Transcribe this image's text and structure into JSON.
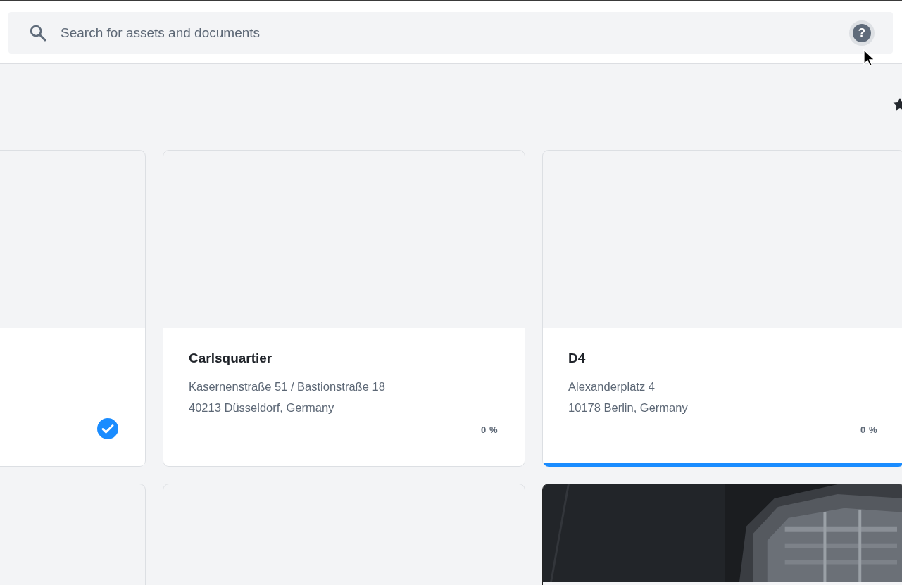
{
  "search": {
    "placeholder": "Search for assets and documents"
  },
  "help_button": {
    "label": "?"
  },
  "cards": [
    {
      "kind": "project",
      "checked": true,
      "selected": false
    },
    {
      "kind": "project",
      "title": "Carlsquartier",
      "address": "Kasernenstraße 51 / Bastionstraße 18",
      "city": "40213 Düsseldorf, Germany",
      "progress": "0 %",
      "checked": false,
      "selected": false
    },
    {
      "kind": "project",
      "title": "D4",
      "address": "Alexanderplatz 4",
      "city": "10178 Berlin, Germany",
      "progress": "0 %",
      "checked": false,
      "selected": true
    },
    {
      "kind": "empty"
    },
    {
      "kind": "empty"
    },
    {
      "kind": "picture"
    }
  ]
}
